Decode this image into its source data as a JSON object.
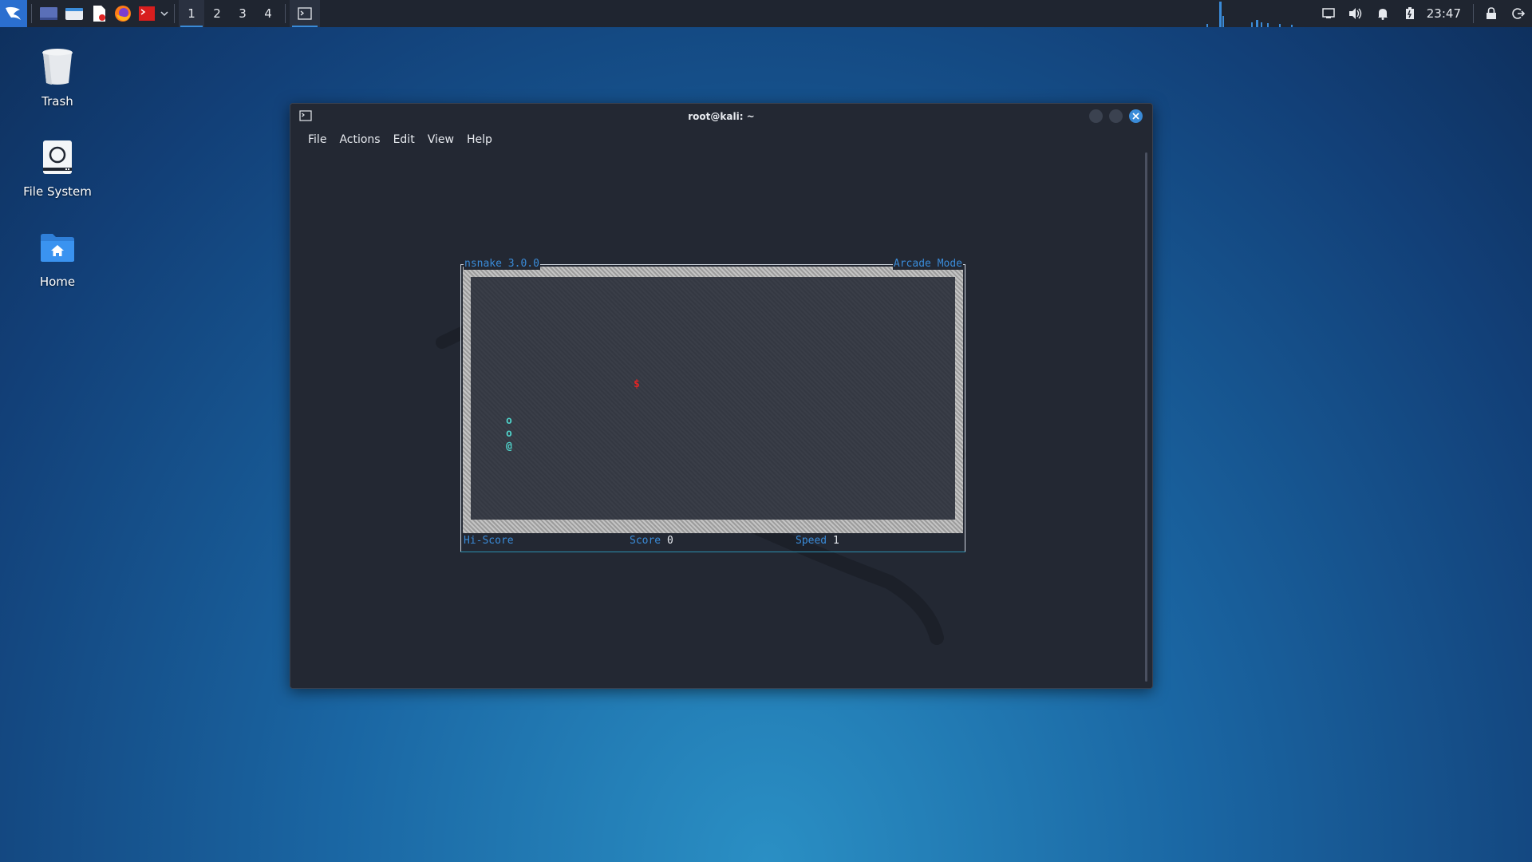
{
  "panel": {
    "workspaces": [
      "1",
      "2",
      "3",
      "4"
    ],
    "active_workspace": "1",
    "clock": "23:47",
    "accent": "#3a8bd8",
    "app_icons": [
      "kali-menu-icon",
      "desktop-icon",
      "file-manager-icon",
      "text-editor-icon",
      "firefox-icon",
      "terminal-launcher-icon",
      "launcher-dropdown-icon"
    ],
    "tray_icons": [
      "display-icon",
      "volume-icon",
      "notification-bell-icon",
      "battery-icon",
      "lock-icon",
      "logout-icon"
    ]
  },
  "desktop": {
    "icons": [
      {
        "label": "Trash",
        "icon": "trash-icon"
      },
      {
        "label": "File System",
        "icon": "drive-icon"
      },
      {
        "label": "Home",
        "icon": "home-folder-icon"
      }
    ]
  },
  "window": {
    "title": "root@kali: ~",
    "menu": [
      "File",
      "Actions",
      "Edit",
      "View",
      "Help"
    ]
  },
  "game": {
    "title": "nsnake 3.0.0",
    "mode": "Arcade Mode",
    "food": "$",
    "snake": [
      "o",
      "o",
      "@"
    ],
    "hiscore_label": "Hi-Score",
    "hiscore_value": "",
    "score_label": "Score",
    "score_value": "0",
    "speed_label": "Speed",
    "speed_value": "1",
    "colors": {
      "food": "#e02424",
      "snake": "#4fd0c8",
      "label": "#3a8bd8"
    }
  }
}
